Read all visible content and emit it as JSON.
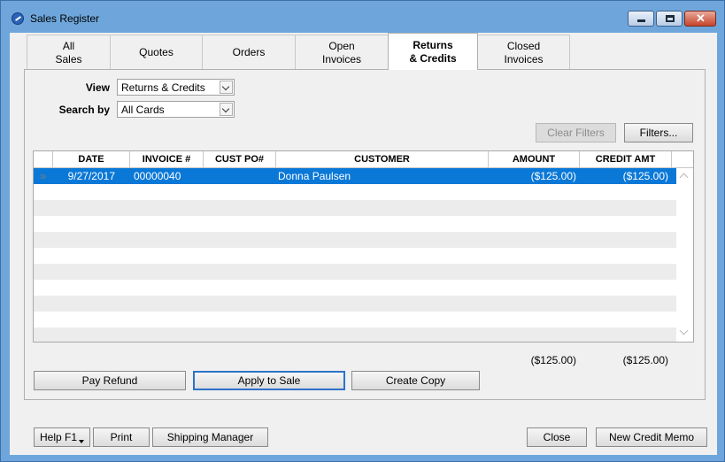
{
  "window": {
    "title": "Sales Register",
    "controls": {
      "minimize": "minimize",
      "maximize": "maximize",
      "close": "✕"
    }
  },
  "tabs": [
    {
      "label": "All\nSales",
      "active": false
    },
    {
      "label": "Quotes",
      "active": false
    },
    {
      "label": "Orders",
      "active": false
    },
    {
      "label": "Open\nInvoices",
      "active": false
    },
    {
      "label": "Returns\n& Credits",
      "active": true
    },
    {
      "label": "Closed\nInvoices",
      "active": false
    }
  ],
  "filters": {
    "view_label": "View",
    "view_value": "Returns & Credits",
    "search_label": "Search by",
    "search_value": "All Cards",
    "clear_filters": "Clear Filters",
    "filters_button": "Filters..."
  },
  "table": {
    "columns": [
      "DATE",
      "INVOICE #",
      "CUST PO#",
      "CUSTOMER",
      "AMOUNT",
      "CREDIT AMT"
    ],
    "rows": [
      {
        "date": "9/27/2017",
        "invoice": "00000040",
        "cust_po": "",
        "customer": "Donna Paulsen",
        "amount": "($125.00)",
        "credit_amt": "($125.00)"
      }
    ],
    "row_marker": "»"
  },
  "totals": {
    "amount": "($125.00)",
    "credit_amt": "($125.00)"
  },
  "actions": {
    "pay_refund": "Pay Refund",
    "apply_to_sale": "Apply to Sale",
    "create_copy": "Create Copy"
  },
  "footer": {
    "help": "Help F1",
    "print": "Print",
    "shipping_manager": "Shipping Manager",
    "close": "Close",
    "new_credit_memo": "New Credit Memo"
  }
}
